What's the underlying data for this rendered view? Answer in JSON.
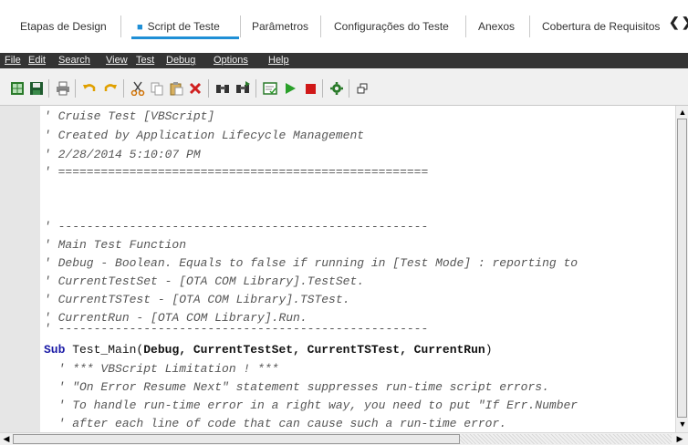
{
  "tabs": [
    {
      "label": "Etapas de Design",
      "active": false
    },
    {
      "label": "Script de Teste",
      "active": true
    },
    {
      "label": "Parâmetros",
      "active": false
    },
    {
      "label": "Configurações do Teste",
      "active": false
    },
    {
      "label": "Anexos",
      "active": false
    },
    {
      "label": "Cobertura de Requisitos",
      "active": false
    }
  ],
  "tab_nav": "❮❯",
  "menu": [
    "File",
    "Edit",
    "Search",
    "View",
    "Test",
    "Debug",
    "Options",
    "Help"
  ],
  "toolbar_icons": [
    "grid-icon",
    "save-icon",
    "print-icon",
    "undo-icon",
    "redo-icon",
    "cut-icon",
    "copy-icon",
    "paste-icon",
    "delete-icon",
    "find-icon",
    "find-next-icon",
    "syntax-check-icon",
    "run-icon",
    "stop-icon",
    "gear-icon",
    "window-icon"
  ],
  "code": {
    "lines": [
      "' Cruise Test [VBScript]",
      "' Created by Application Lifecycle Management",
      "' 2/28/2014 5:10:07 PM",
      "' ====================================================",
      "",
      "",
      "' ----------------------------------------------------",
      "' Main Test Function",
      "' Debug - Boolean. Equals to false if running in [Test Mode] : reporting to",
      "' CurrentTestSet - [OTA COM Library].TestSet.",
      "' CurrentTSTest - [OTA COM Library].TSTest.",
      "' CurrentRun - [OTA COM Library].Run.",
      "' ----------------------------------------------------",
      "",
      "  ' *** VBScript Limitation ! ***",
      "  ' \"On Error Resume Next\" statement suppresses run-time script errors.",
      "  ' To handle run-time error in a right way, you need to put \"If Err.Number",
      "  ' after each line of code that can cause such a run-time error."
    ],
    "sub_keyword": "Sub",
    "sub_name": " Test_Main(",
    "sub_params": "Debug, CurrentTestSet, CurrentTSTest, CurrentRun",
    "sub_close": ")"
  },
  "colors": {
    "accent": "#1f8fd6",
    "menubar": "#343434",
    "gutter": "#e6e6e6"
  }
}
